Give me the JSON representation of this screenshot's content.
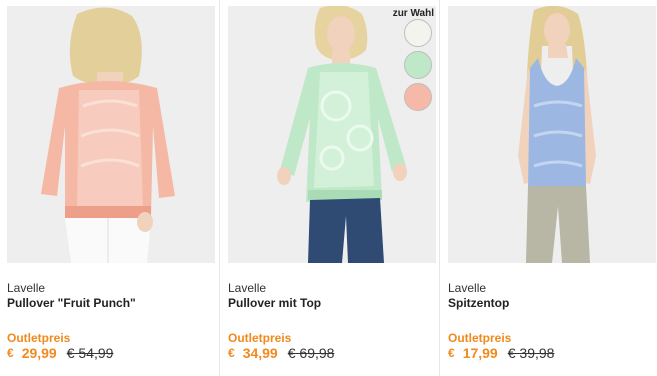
{
  "products": [
    {
      "brand": "Lavelle",
      "name": "Pullover \"Fruit Punch\"",
      "outlet_label": "Outletpreis",
      "currency": "€",
      "price": "29,99",
      "old_price": "€ 54,99"
    },
    {
      "brand": "Lavelle",
      "name": "Pullover mit Top",
      "outlet_label": "Outletpreis",
      "currency": "€",
      "price": "34,99",
      "old_price": "€ 69,98",
      "variants_label": "zur Wahl",
      "variant_colors": [
        "#f4f4ef",
        "#bfe8c8",
        "#f6b9a8"
      ]
    },
    {
      "brand": "Lavelle",
      "name": "Spitzentop",
      "outlet_label": "Outletpreis",
      "currency": "€",
      "price": "17,99",
      "old_price": "€ 39,98"
    }
  ],
  "colors": {
    "accent_orange": "#f08a1d",
    "photo_background": "#eeeeee",
    "top_peach": "#f4b8a4",
    "top_mint": "#bfe8c8",
    "top_blue": "#9db7e3"
  }
}
